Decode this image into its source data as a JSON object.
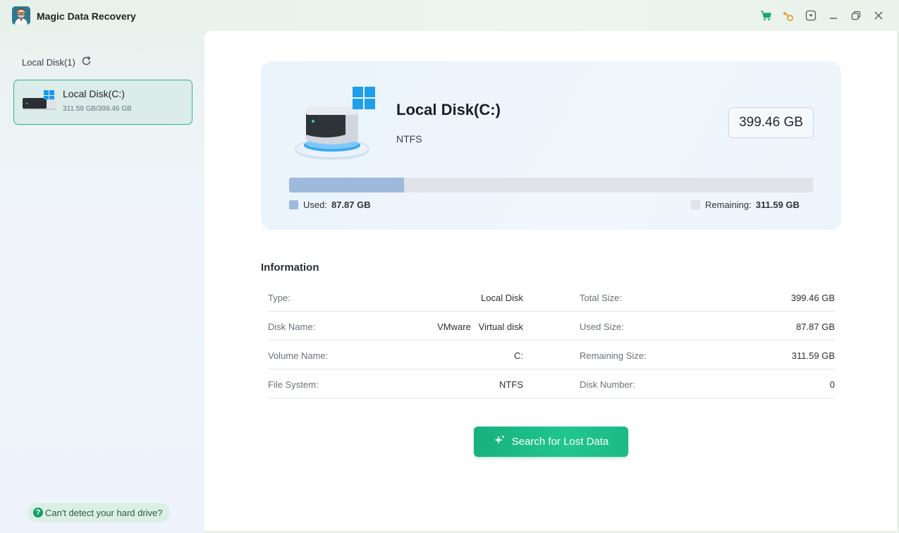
{
  "app": {
    "title": "Magic Data Recovery"
  },
  "titlebar_icons": [
    "cart-icon",
    "key-icon",
    "menu-dropdown-icon",
    "minimize-icon",
    "restore-icon",
    "close-icon"
  ],
  "sidebar": {
    "header": "Local Disk(1)",
    "disks": [
      {
        "name": "Local Disk(C:)",
        "size": "311.59 GB/399.46 GB"
      }
    ],
    "help": "Can't detect your hard drive?"
  },
  "disk": {
    "name": "Local Disk(C:)",
    "filesystem": "NTFS",
    "total": "399.46 GB",
    "used_fraction": 0.22,
    "used_label": "Used:",
    "used_value": "87.87 GB",
    "remaining_label": "Remaining:",
    "remaining_value": "311.59 GB"
  },
  "info": {
    "title": "Information",
    "rows": [
      {
        "k1": "Type:",
        "v1": "Local Disk",
        "k2": "Total Size:",
        "v2": "399.46 GB"
      },
      {
        "k1": "Disk Name:",
        "v1": "VMware   Virtual disk",
        "k2": "Used Size:",
        "v2": "87.87 GB"
      },
      {
        "k1": "Volume Name:",
        "v1": "C:",
        "k2": "Remaining Size:",
        "v2": "311.59 GB"
      },
      {
        "k1": "File System:",
        "v1": "NTFS",
        "k2": "Disk Number:",
        "v2": "0"
      }
    ]
  },
  "actions": {
    "search": "Search for Lost Data"
  },
  "colors": {
    "accent": "#1fbf8a",
    "used": "#9db9dc",
    "remaining": "#e1e3e8"
  }
}
